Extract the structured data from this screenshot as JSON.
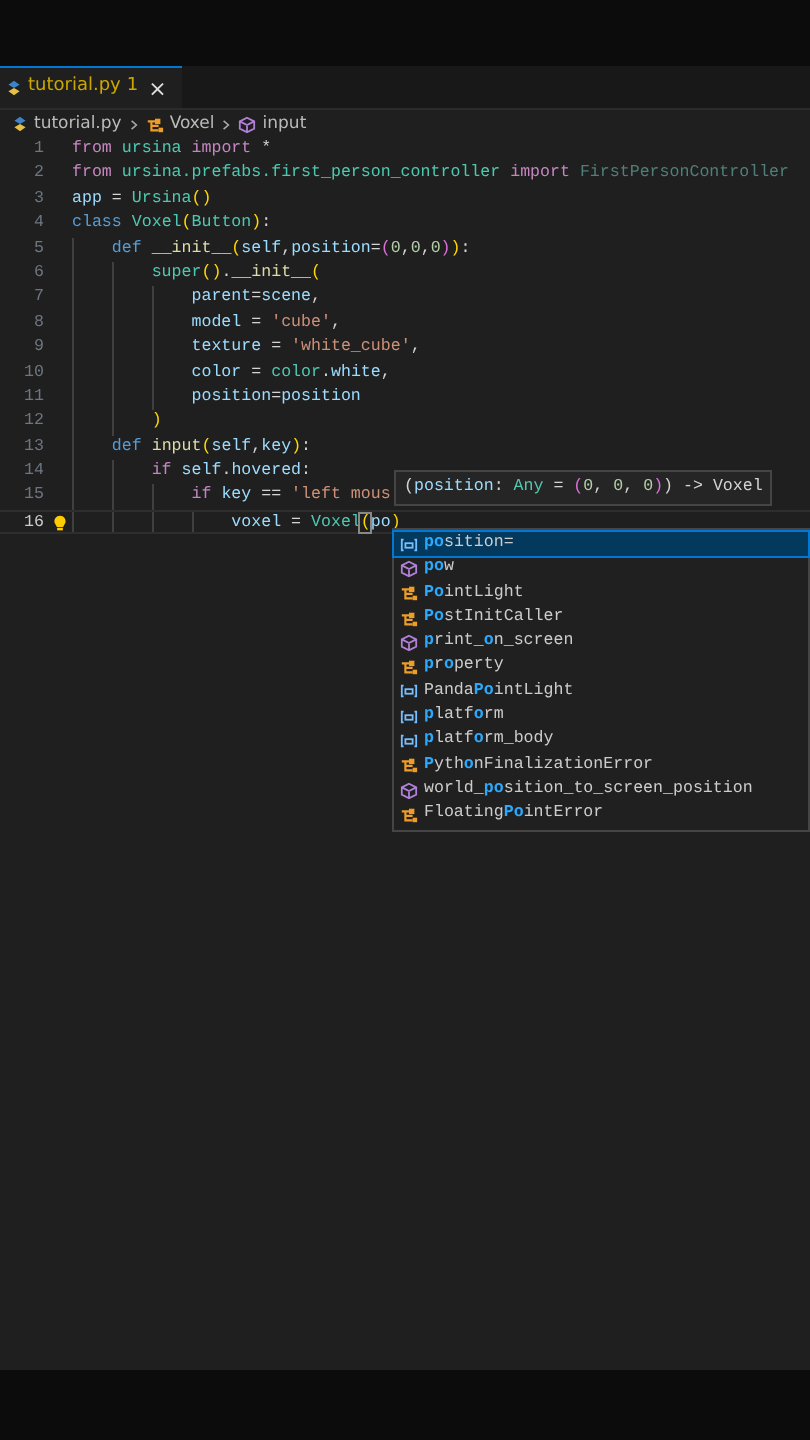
{
  "tab": {
    "label": "tutorial.py",
    "problems": "1",
    "close": "×",
    "selected": true
  },
  "breadcrumbs": [
    {
      "kind": "file",
      "label": "tutorial.py"
    },
    {
      "kind": "class",
      "label": "Voxel"
    },
    {
      "kind": "method",
      "label": "input"
    }
  ],
  "code": [
    {
      "number": "1",
      "current": false,
      "tokens": [
        {
          "kind": "kw",
          "text": "from"
        },
        {
          "kind": "cls",
          "text": " ursina"
        },
        {
          "kind": "kw",
          "text": " import"
        },
        {
          "kind": "plain",
          "text": " *"
        }
      ]
    },
    {
      "number": "2",
      "current": false,
      "tokens": [
        {
          "kind": "kw",
          "text": "from"
        },
        {
          "kind": "cls",
          "text": " ursina.prefabs.first_person_controller"
        },
        {
          "kind": "kw",
          "text": " import"
        },
        {
          "kind": "dim",
          "text": " FirstPersonController"
        }
      ]
    },
    {
      "number": "3",
      "current": false,
      "tokens": [
        {
          "kind": "var",
          "text": "app"
        },
        {
          "kind": "plain",
          "text": " ="
        },
        {
          "kind": "cls",
          "text": " Ursina"
        },
        {
          "kind": "br1",
          "text": "()"
        }
      ]
    },
    {
      "number": "4",
      "current": false,
      "tokens": [
        {
          "kind": "kw2",
          "text": "class"
        },
        {
          "kind": "cls",
          "text": " Voxel"
        },
        {
          "kind": "br1",
          "text": "("
        },
        {
          "kind": "cls",
          "text": "Button"
        },
        {
          "kind": "br1",
          "text": ")"
        },
        {
          "kind": "plain",
          "text": ":"
        }
      ]
    },
    {
      "number": "5",
      "current": false,
      "tokens": [
        {
          "kind": "kw2",
          "text": "    def"
        },
        {
          "kind": "fn",
          "text": " __init__"
        },
        {
          "kind": "br1",
          "text": "("
        },
        {
          "kind": "var",
          "text": "self"
        },
        {
          "kind": "plain",
          "text": ","
        },
        {
          "kind": "var",
          "text": "position"
        },
        {
          "kind": "plain",
          "text": "="
        },
        {
          "kind": "br2",
          "text": "("
        },
        {
          "kind": "num",
          "text": "0"
        },
        {
          "kind": "plain",
          "text": ","
        },
        {
          "kind": "num",
          "text": "0"
        },
        {
          "kind": "plain",
          "text": ","
        },
        {
          "kind": "num",
          "text": "0"
        },
        {
          "kind": "br2",
          "text": ")"
        },
        {
          "kind": "br1",
          "text": ")"
        },
        {
          "kind": "plain",
          "text": ":"
        }
      ]
    },
    {
      "number": "6",
      "current": false,
      "tokens": [
        {
          "kind": "cls",
          "text": "        super"
        },
        {
          "kind": "br1",
          "text": "()"
        },
        {
          "kind": "plain",
          "text": "."
        },
        {
          "kind": "fn",
          "text": "__init__"
        },
        {
          "kind": "br1",
          "text": "("
        }
      ]
    },
    {
      "number": "7",
      "current": false,
      "tokens": [
        {
          "kind": "var",
          "text": "            parent"
        },
        {
          "kind": "plain",
          "text": "="
        },
        {
          "kind": "var",
          "text": "scene"
        },
        {
          "kind": "plain",
          "text": ","
        }
      ]
    },
    {
      "number": "8",
      "current": false,
      "tokens": [
        {
          "kind": "var",
          "text": "            model"
        },
        {
          "kind": "plain",
          "text": " ="
        },
        {
          "kind": "str",
          "text": " 'cube'"
        },
        {
          "kind": "plain",
          "text": ","
        }
      ]
    },
    {
      "number": "9",
      "current": false,
      "tokens": [
        {
          "kind": "var",
          "text": "            texture"
        },
        {
          "kind": "plain",
          "text": " ="
        },
        {
          "kind": "str",
          "text": " 'white_cube'"
        },
        {
          "kind": "plain",
          "text": ","
        }
      ]
    },
    {
      "number": "10",
      "current": false,
      "tokens": [
        {
          "kind": "var",
          "text": "            color"
        },
        {
          "kind": "plain",
          "text": " ="
        },
        {
          "kind": "cls",
          "text": " color"
        },
        {
          "kind": "plain",
          "text": "."
        },
        {
          "kind": "var",
          "text": "white"
        },
        {
          "kind": "plain",
          "text": ","
        }
      ]
    },
    {
      "number": "11",
      "current": false,
      "tokens": [
        {
          "kind": "var",
          "text": "            position"
        },
        {
          "kind": "plain",
          "text": "="
        },
        {
          "kind": "var",
          "text": "position"
        }
      ]
    },
    {
      "number": "12",
      "current": false,
      "tokens": [
        {
          "kind": "br1",
          "text": "        )"
        }
      ]
    },
    {
      "number": "13",
      "current": false,
      "tokens": [
        {
          "kind": "kw2",
          "text": "    def"
        },
        {
          "kind": "fn",
          "text": " input"
        },
        {
          "kind": "br1",
          "text": "("
        },
        {
          "kind": "var",
          "text": "self"
        },
        {
          "kind": "plain",
          "text": ","
        },
        {
          "kind": "var",
          "text": "key"
        },
        {
          "kind": "br1",
          "text": ")"
        },
        {
          "kind": "plain",
          "text": ":"
        }
      ]
    },
    {
      "number": "14",
      "current": false,
      "tokens": [
        {
          "kind": "kw",
          "text": "        if"
        },
        {
          "kind": "var",
          "text": " self"
        },
        {
          "kind": "plain",
          "text": "."
        },
        {
          "kind": "var",
          "text": "hovered"
        },
        {
          "kind": "plain",
          "text": ":"
        }
      ]
    },
    {
      "number": "15",
      "current": false,
      "tokens": [
        {
          "kind": "kw",
          "text": "            if"
        },
        {
          "kind": "var",
          "text": " key"
        },
        {
          "kind": "plain",
          "text": " =="
        },
        {
          "kind": "str",
          "text": " 'left mous"
        }
      ]
    },
    {
      "number": "16",
      "current": true,
      "tokens": [
        {
          "kind": "var",
          "text": "                voxel"
        },
        {
          "kind": "plain",
          "text": " ="
        },
        {
          "kind": "cls",
          "text": " Voxel"
        },
        {
          "kind": "brm",
          "text": "("
        },
        {
          "kind": "var",
          "text": "po"
        },
        {
          "kind": "br1",
          "text": ")"
        }
      ]
    }
  ],
  "hint": [
    {
      "kind": "plain",
      "text": "("
    },
    {
      "kind": "param",
      "text": "position"
    },
    {
      "kind": "plain",
      "text": ":"
    },
    {
      "kind": "cls",
      "text": " Any"
    },
    {
      "kind": "plain",
      "text": " ="
    },
    {
      "kind": "br2",
      "text": " ("
    },
    {
      "kind": "num",
      "text": "0"
    },
    {
      "kind": "plain",
      "text": ","
    },
    {
      "kind": "num",
      "text": " 0"
    },
    {
      "kind": "plain",
      "text": ","
    },
    {
      "kind": "num",
      "text": " 0"
    },
    {
      "kind": "br2",
      "text": ")"
    },
    {
      "kind": "plain",
      "text": ") -> Voxel"
    }
  ],
  "suggestions": [
    {
      "kind": "variable",
      "selected": true,
      "segments": [
        {
          "text": "po",
          "match": true
        },
        {
          "text": "sition=",
          "match": false
        }
      ]
    },
    {
      "kind": "method",
      "selected": false,
      "segments": [
        {
          "text": "po",
          "match": true
        },
        {
          "text": "w",
          "match": false
        }
      ]
    },
    {
      "kind": "class",
      "selected": false,
      "segments": [
        {
          "text": "Po",
          "match": true
        },
        {
          "text": "intLight",
          "match": false
        }
      ]
    },
    {
      "kind": "class",
      "selected": false,
      "segments": [
        {
          "text": "Po",
          "match": true
        },
        {
          "text": "stInitCaller",
          "match": false
        }
      ]
    },
    {
      "kind": "method",
      "selected": false,
      "segments": [
        {
          "text": "p",
          "match": true
        },
        {
          "text": "rint_",
          "match": false
        },
        {
          "text": "o",
          "match": true
        },
        {
          "text": "n_screen",
          "match": false
        }
      ]
    },
    {
      "kind": "class",
      "selected": false,
      "segments": [
        {
          "text": "p",
          "match": true
        },
        {
          "text": "r",
          "match": false
        },
        {
          "text": "o",
          "match": true
        },
        {
          "text": "perty",
          "match": false
        }
      ]
    },
    {
      "kind": "variable",
      "selected": false,
      "segments": [
        {
          "text": "Panda",
          "match": false
        },
        {
          "text": "Po",
          "match": true
        },
        {
          "text": "intLight",
          "match": false
        }
      ]
    },
    {
      "kind": "variable",
      "selected": false,
      "segments": [
        {
          "text": "p",
          "match": true
        },
        {
          "text": "latf",
          "match": false
        },
        {
          "text": "o",
          "match": true
        },
        {
          "text": "rm",
          "match": false
        }
      ]
    },
    {
      "kind": "variable",
      "selected": false,
      "segments": [
        {
          "text": "p",
          "match": true
        },
        {
          "text": "latf",
          "match": false
        },
        {
          "text": "o",
          "match": true
        },
        {
          "text": "rm_body",
          "match": false
        }
      ]
    },
    {
      "kind": "class",
      "selected": false,
      "segments": [
        {
          "text": "P",
          "match": true
        },
        {
          "text": "yth",
          "match": false
        },
        {
          "text": "o",
          "match": true
        },
        {
          "text": "nFinalizationError",
          "match": false
        }
      ]
    },
    {
      "kind": "method",
      "selected": false,
      "segments": [
        {
          "text": "world_",
          "match": false
        },
        {
          "text": "po",
          "match": true
        },
        {
          "text": "sition_to_screen_position",
          "match": false
        }
      ]
    },
    {
      "kind": "class",
      "selected": false,
      "segments": [
        {
          "text": "Floating",
          "match": false
        },
        {
          "text": "Po",
          "match": true
        },
        {
          "text": "intError",
          "match": false
        }
      ]
    }
  ]
}
